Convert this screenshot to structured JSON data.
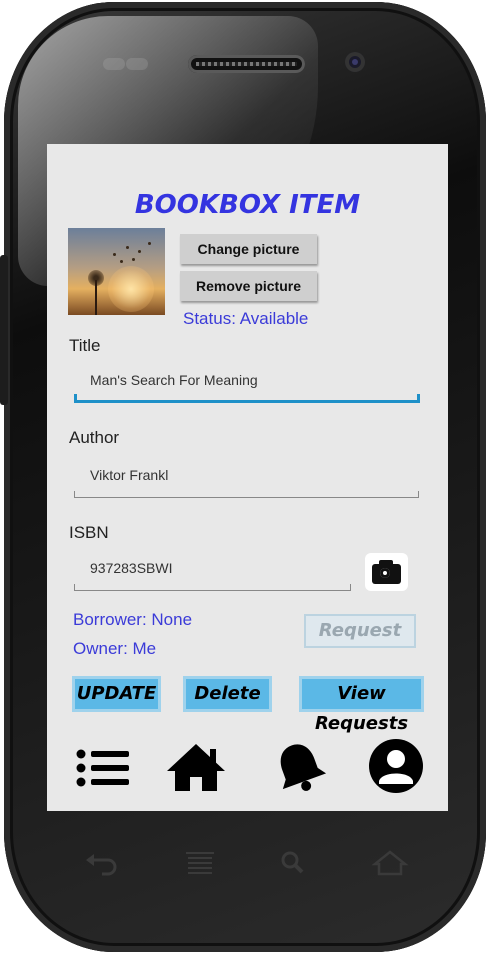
{
  "screen": {
    "title": "BOOKBOX ITEM",
    "picture_buttons": {
      "change": "Change picture",
      "remove": "Remove picture"
    },
    "status": "Status: Available",
    "fields": {
      "title": {
        "label": "Title",
        "value": "Man's Search For Meaning"
      },
      "author": {
        "label": "Author",
        "value": "Viktor Frankl"
      },
      "isbn": {
        "label": "ISBN",
        "value": "937283SBWI"
      }
    },
    "borrower": "Borrower: None",
    "owner": "Owner: Me",
    "request_button": "Request",
    "actions": {
      "update": "UPDATE",
      "delete": "Delete",
      "view_requests": "View Requests"
    },
    "nav": [
      {
        "icon": "list-icon"
      },
      {
        "icon": "home-icon"
      },
      {
        "icon": "bell-icon"
      },
      {
        "icon": "profile-icon"
      }
    ]
  },
  "hardware_keys": [
    {
      "icon": "back-icon"
    },
    {
      "icon": "menu-icon"
    },
    {
      "icon": "search-icon"
    },
    {
      "icon": "home-key-icon"
    }
  ],
  "colors": {
    "accent": "#3b3bd8",
    "button_blue": "#5bb8e6",
    "active_underline": "#1e90c8"
  }
}
